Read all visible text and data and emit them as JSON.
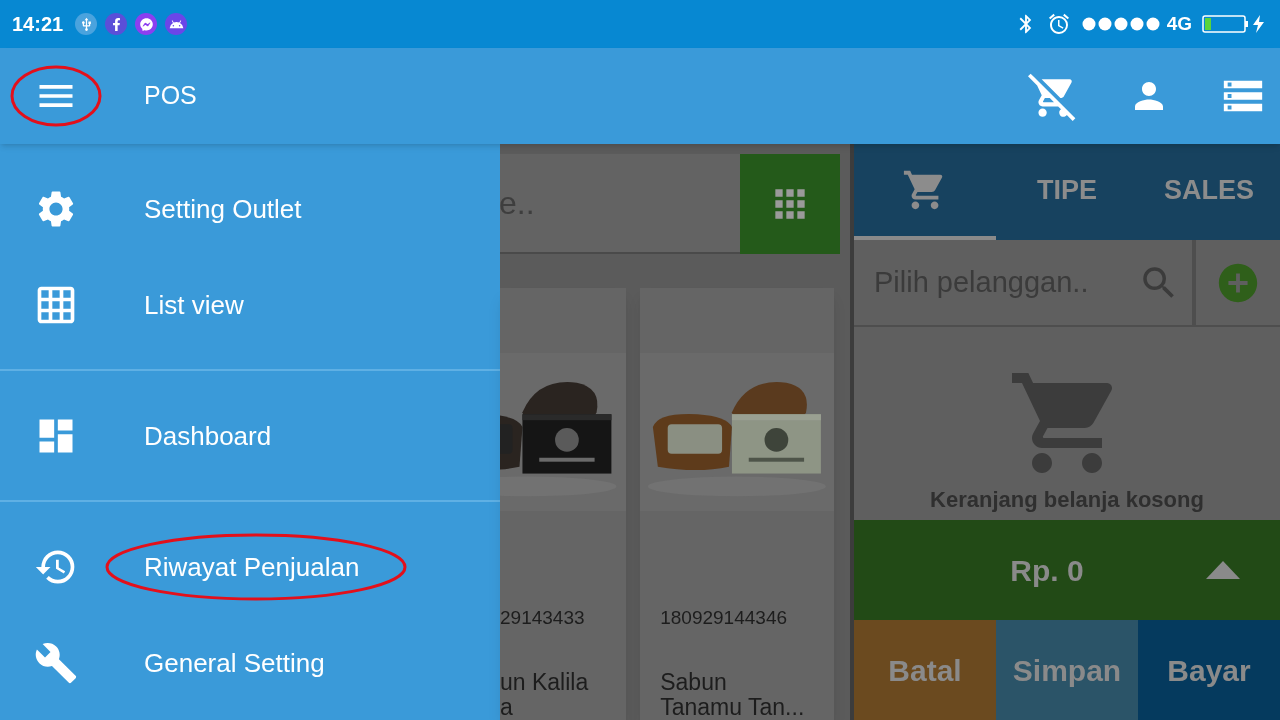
{
  "status_bar": {
    "time": "14:21",
    "network": "4G"
  },
  "app_bar": {
    "title": "POS",
    "menu_circled": true
  },
  "drawer": {
    "groups": [
      [
        {
          "label": "Setting Outlet",
          "circled": false
        },
        {
          "label": "List view",
          "circled": false
        }
      ],
      [
        {
          "label": "Dashboard",
          "circled": false
        }
      ],
      [
        {
          "label": "Riwayat Penjualan",
          "circled": true
        },
        {
          "label": "General Setting",
          "circled": false
        }
      ]
    ]
  },
  "product_search": {
    "placeholder": "e.."
  },
  "products": [
    {
      "code": "29143433",
      "name": "un Kalila\na",
      "kind": "picture"
    },
    {
      "code": "180929144346",
      "name": "Sabun\nTanamu Tan...",
      "kind": "picture"
    }
  ],
  "cart": {
    "tabs": [
      {
        "kind": "icon",
        "selected": true
      },
      {
        "kind": "text",
        "label": "TIPE",
        "selected": false
      },
      {
        "kind": "text",
        "label": "SALES",
        "selected": false
      }
    ],
    "customer_search": {
      "placeholder": "Pilih pelanggan.."
    },
    "empty_message": "Keranjang belanja kosong",
    "total": "Rp. 0",
    "actions": [
      {
        "label": "Batal",
        "color": "#6b4a1f"
      },
      {
        "label": "Simpan",
        "color": "#2b5468"
      },
      {
        "label": "Bayar",
        "color": "#053a5e"
      }
    ]
  }
}
